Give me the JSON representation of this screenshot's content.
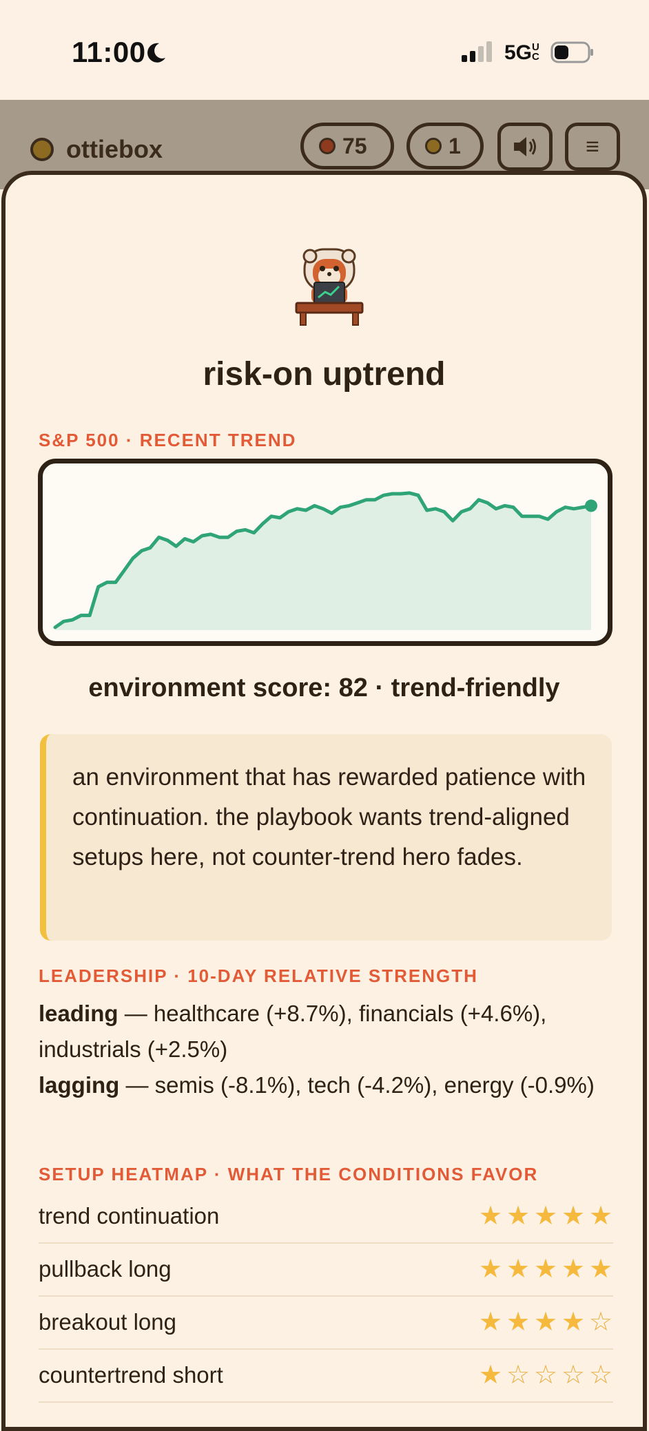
{
  "status_bar": {
    "time": "11:00",
    "network": "5G",
    "network_badge": "UC"
  },
  "header": {
    "brand": "ottiebox",
    "hearts": "75",
    "coins": "1",
    "sound_icon": "speaker-icon",
    "menu_icon": "≡"
  },
  "sheet": {
    "title": "risk-on uptrend",
    "trend_label": "S&P 500 · RECENT TREND",
    "env_score": "environment score: 82 · trend-friendly",
    "note": "an environment that has rewarded patience with continuation. the playbook wants trend-aligned setups here, not counter-trend hero fades.",
    "leadership_label": "LEADERSHIP · 10-DAY RELATIVE STRENGTH",
    "leading_label": "leading",
    "leading_text": " — healthcare (+8.7%), financials (+4.6%), industrials (+2.5%)",
    "lagging_label": "lagging",
    "lagging_text": " — semis (-8.1%), tech (-4.2%), energy (-0.9%)",
    "heatmap_label": "SETUP HEATMAP · WHAT THE CONDITIONS FAVOR",
    "heatmap": [
      {
        "label": "trend continuation",
        "stars": 5
      },
      {
        "label": "pullback long",
        "stars": 5
      },
      {
        "label": "breakout long",
        "stars": 4
      },
      {
        "label": "countertrend short",
        "stars": 1
      }
    ]
  },
  "colors": {
    "accent": "#e25a36",
    "line": "#2fa477",
    "fill": "#e0efe4",
    "star": "#f4b93d",
    "callout_bar": "#f1c03d"
  },
  "chart_data": {
    "type": "area",
    "title": "",
    "xlabel": "",
    "ylabel": "",
    "x": [
      1,
      2,
      3,
      4,
      5,
      6,
      7,
      8,
      9,
      10,
      11,
      12,
      13,
      14,
      15,
      16,
      17,
      18,
      19,
      20,
      21,
      22,
      23,
      24,
      25,
      26,
      27,
      28,
      29,
      30,
      31,
      32,
      33,
      34,
      35,
      36,
      37,
      38,
      39,
      40,
      41,
      42,
      43,
      44,
      45,
      46,
      47,
      48,
      49,
      50,
      51,
      52,
      53,
      54,
      55,
      56,
      57,
      58,
      59,
      60,
      61,
      62,
      63,
      64,
      65,
      66
    ],
    "values": [
      0,
      4,
      5,
      8,
      8,
      27,
      30,
      30,
      38,
      46,
      51,
      53,
      60,
      58,
      54,
      59,
      57,
      61,
      62,
      60,
      60,
      64,
      65,
      63,
      69,
      74,
      73,
      77,
      79,
      78,
      81,
      79,
      76,
      80,
      81,
      83,
      85,
      85,
      88,
      89,
      89,
      89.5,
      88,
      78,
      79,
      77,
      71,
      77,
      79,
      85,
      83,
      79,
      81,
      80,
      74,
      74,
      74,
      72,
      77,
      80,
      79,
      80,
      81
    ],
    "ylim": [
      0,
      100
    ],
    "grid": false,
    "legend": "none"
  }
}
